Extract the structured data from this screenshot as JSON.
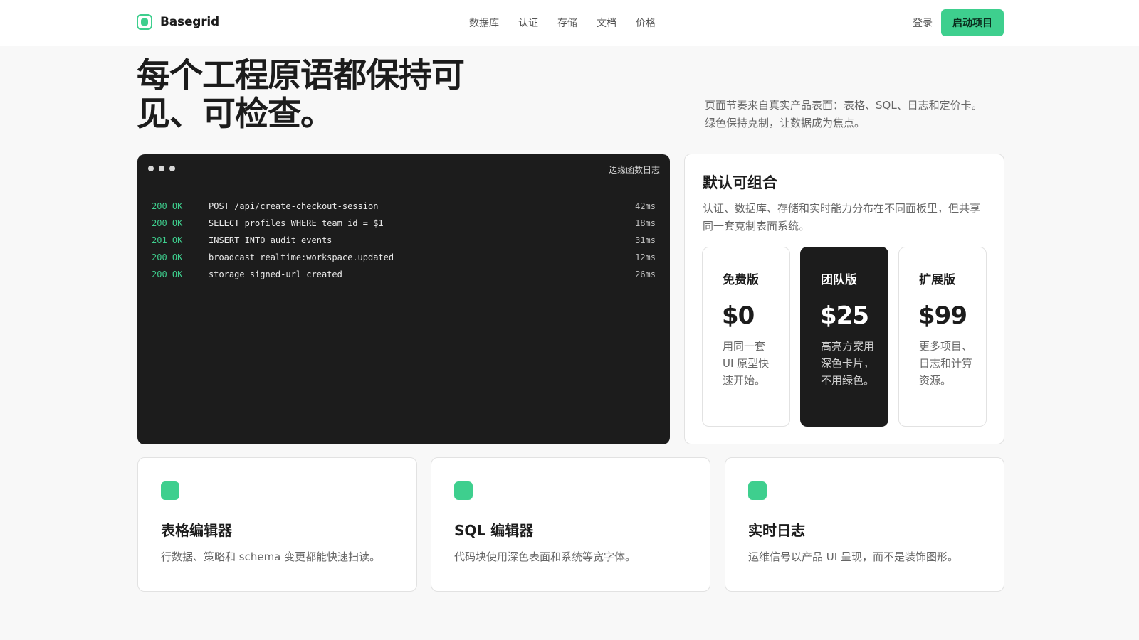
{
  "nav": {
    "brand": "Basegrid",
    "links": [
      "数据库",
      "认证",
      "存储",
      "文档",
      "价格"
    ],
    "login": "登录",
    "cta": "启动项目"
  },
  "hero": {
    "title_line1": "每个工程原语都保持可",
    "title_line2": "见、可检查。",
    "subtitle_line1": "页面节奏来自真实产品表面：表格、SQL、日志和定价卡。",
    "subtitle_line2": "绿色保持克制，让数据成为焦点。"
  },
  "log_panel": {
    "title": "边缘函数日志",
    "rows": [
      {
        "status": "200 OK",
        "message": "POST /api/create-checkout-session",
        "time": "42ms"
      },
      {
        "status": "200 OK",
        "message": "SELECT profiles WHERE team_id = $1",
        "time": "18ms"
      },
      {
        "status": "201 OK",
        "message": "INSERT INTO audit_events",
        "time": "31ms"
      },
      {
        "status": "200 OK",
        "message": "broadcast realtime:workspace.updated",
        "time": "12ms"
      },
      {
        "status": "200 OK",
        "message": "storage signed-url created",
        "time": "26ms"
      }
    ]
  },
  "pricing": {
    "title": "默认可组合",
    "description": "认证、数据库、存储和实时能力分布在不同面板里，但共享同一套克制表面系统。",
    "tiers": [
      {
        "name": "免费版",
        "price": "$0",
        "text": "用同一套 UI 原型快速开始。"
      },
      {
        "name": "团队版",
        "price": "$25",
        "text": "高亮方案用深色卡片，不用绿色。"
      },
      {
        "name": "扩展版",
        "price": "$99",
        "text": "更多项目、日志和计算资源。"
      }
    ]
  },
  "features": [
    {
      "title": "表格编辑器",
      "text": "行数据、策略和 schema 变更都能快速扫读。"
    },
    {
      "title": "SQL 编辑器",
      "text": "代码块使用深色表面和系统等宽字体。"
    },
    {
      "title": "实时日志",
      "text": "运维信号以产品 UI 呈现，而不是装饰图形。"
    }
  ],
  "colors": {
    "accent": "#3ecf8e",
    "dark_surface": "#1c1c1c",
    "page_bg": "#f8f8f8"
  }
}
